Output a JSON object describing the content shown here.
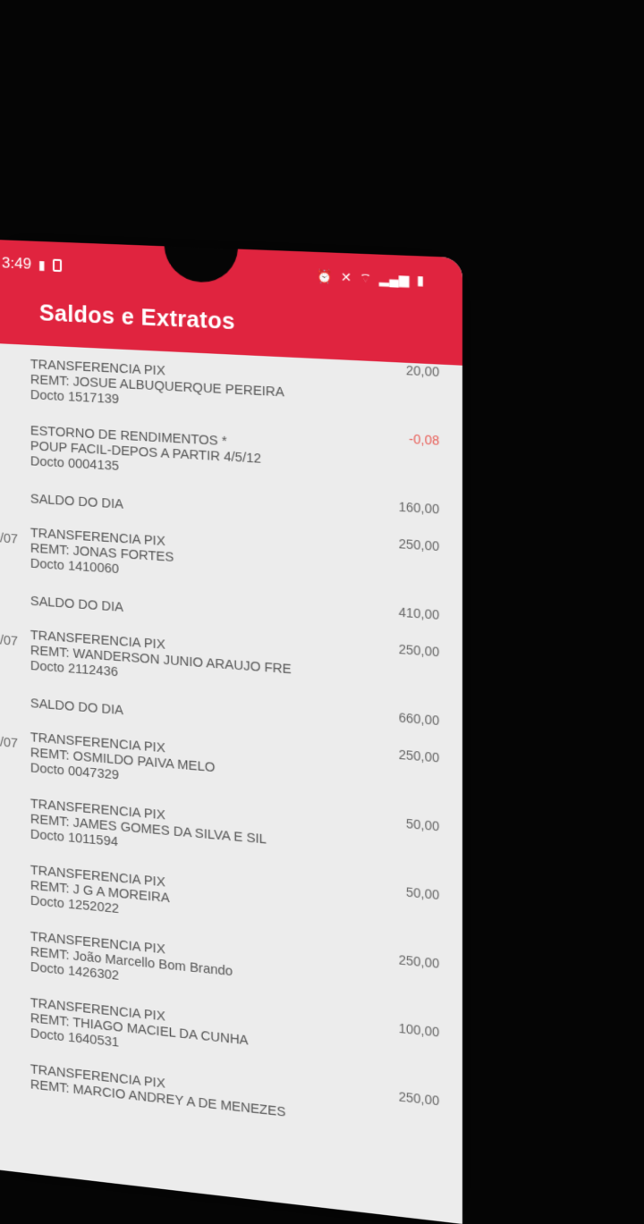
{
  "status": {
    "time": "3:49"
  },
  "header": {
    "title": "Saldos e Extratos"
  },
  "entries": [
    {
      "date": "",
      "l1": "TRANSFERENCIA PIX",
      "l2": "REMT: JOSUE ALBUQUERQUE PEREIRA",
      "l3": "Docto 1517139",
      "amount": "20,00",
      "kind": "tx"
    },
    {
      "date": "",
      "l1": "ESTORNO DE RENDIMENTOS *",
      "l2": "POUP FACIL-DEPOS A PARTIR 4/5/12",
      "l3": "Docto 0004135",
      "amount": "-0,08",
      "kind": "tx"
    },
    {
      "date": "",
      "l1": "SALDO DO DIA",
      "l2": "",
      "l3": "",
      "amount": "160,00",
      "kind": "saldo"
    },
    {
      "date": "/07",
      "l1": "TRANSFERENCIA PIX",
      "l2": "REMT: JONAS FORTES",
      "l3": "Docto 1410060",
      "amount": "250,00",
      "kind": "tx"
    },
    {
      "date": "",
      "l1": "SALDO DO DIA",
      "l2": "",
      "l3": "",
      "amount": "410,00",
      "kind": "saldo"
    },
    {
      "date": "/07",
      "l1": "TRANSFERENCIA PIX",
      "l2": "REMT: WANDERSON JUNIO ARAUJO FRE",
      "l3": "Docto 2112436",
      "amount": "250,00",
      "kind": "tx"
    },
    {
      "date": "",
      "l1": "SALDO DO DIA",
      "l2": "",
      "l3": "",
      "amount": "660,00",
      "kind": "saldo"
    },
    {
      "date": "/07",
      "l1": "TRANSFERENCIA PIX",
      "l2": "REMT: OSMILDO PAIVA MELO",
      "l3": "Docto 0047329",
      "amount": "250,00",
      "kind": "tx"
    },
    {
      "date": "",
      "l1": "TRANSFERENCIA PIX",
      "l2": "REMT: JAMES GOMES DA SILVA E SIL",
      "l3": "Docto 1011594",
      "amount": "50,00",
      "kind": "tx"
    },
    {
      "date": "",
      "l1": "TRANSFERENCIA PIX",
      "l2": "REMT: J G A MOREIRA",
      "l3": "Docto 1252022",
      "amount": "50,00",
      "kind": "tx"
    },
    {
      "date": "",
      "l1": "TRANSFERENCIA PIX",
      "l2": "REMT: João Marcello Bom Brando",
      "l3": "Docto 1426302",
      "amount": "250,00",
      "kind": "tx"
    },
    {
      "date": "",
      "l1": "TRANSFERENCIA PIX",
      "l2": "REMT: THIAGO MACIEL DA CUNHA",
      "l3": "Docto 1640531",
      "amount": "100,00",
      "kind": "tx"
    },
    {
      "date": "",
      "l1": "TRANSFERENCIA PIX",
      "l2": "REMT: MARCIO ANDREY A DE MENEZES",
      "l3": "",
      "amount": "250,00",
      "kind": "tx"
    }
  ]
}
